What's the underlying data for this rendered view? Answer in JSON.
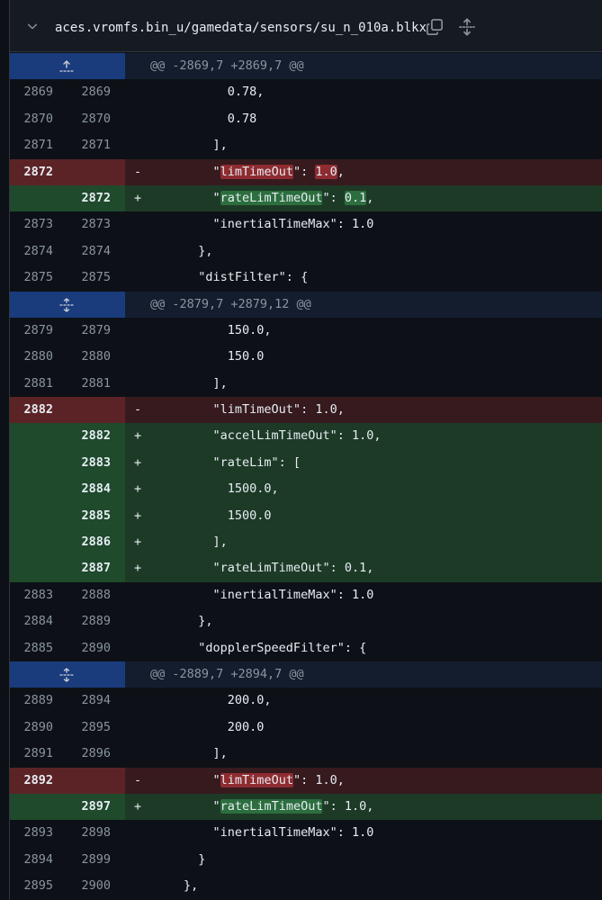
{
  "file": {
    "path": "aces.vromfs.bin_u/gamedata/sensors/su_n_010a.blkx",
    "icons": [
      "chevron-down-icon",
      "copy-icon",
      "expand-all-icon"
    ]
  },
  "colors": {
    "background": "#0d1117",
    "deletion_line": "#361a1e",
    "deletion_gutter": "#5c2326",
    "addition_line": "#1d3a27",
    "addition_gutter": "#1f4a2c",
    "hunk_gutter": "#1a3b7c"
  },
  "rows": [
    {
      "type": "hunk",
      "text": "@@ -2869,7 +2869,7 @@",
      "icon": "expand-up-icon"
    },
    {
      "type": "context",
      "old": "2869",
      "new": "2869",
      "marker": "",
      "segments": [
        {
          "t": "              0.78,"
        }
      ]
    },
    {
      "type": "context",
      "old": "2870",
      "new": "2870",
      "marker": "",
      "segments": [
        {
          "t": "              0.78"
        }
      ]
    },
    {
      "type": "context",
      "old": "2871",
      "new": "2871",
      "marker": "",
      "segments": [
        {
          "t": "            ],"
        }
      ]
    },
    {
      "type": "del",
      "old": "2872",
      "new": "",
      "marker": "-",
      "segments": [
        {
          "t": "            \""
        },
        {
          "t": "limTimeOut",
          "hl": true
        },
        {
          "t": "\": "
        },
        {
          "t": "1.0",
          "hl": true
        },
        {
          "t": ","
        }
      ]
    },
    {
      "type": "add",
      "old": "",
      "new": "2872",
      "marker": "+",
      "segments": [
        {
          "t": "            \""
        },
        {
          "t": "rateLimTimeOut",
          "hl": true
        },
        {
          "t": "\": "
        },
        {
          "t": "0.1",
          "hl": true
        },
        {
          "t": ","
        }
      ]
    },
    {
      "type": "context",
      "old": "2873",
      "new": "2873",
      "marker": "",
      "segments": [
        {
          "t": "            \"inertialTimeMax\": 1.0"
        }
      ]
    },
    {
      "type": "context",
      "old": "2874",
      "new": "2874",
      "marker": "",
      "segments": [
        {
          "t": "          },"
        }
      ]
    },
    {
      "type": "context",
      "old": "2875",
      "new": "2875",
      "marker": "",
      "segments": [
        {
          "t": "          \"distFilter\": {"
        }
      ]
    },
    {
      "type": "hunk",
      "text": "@@ -2879,7 +2879,12 @@",
      "icon": "expand-both-icon"
    },
    {
      "type": "context",
      "old": "2879",
      "new": "2879",
      "marker": "",
      "segments": [
        {
          "t": "              150.0,"
        }
      ]
    },
    {
      "type": "context",
      "old": "2880",
      "new": "2880",
      "marker": "",
      "segments": [
        {
          "t": "              150.0"
        }
      ]
    },
    {
      "type": "context",
      "old": "2881",
      "new": "2881",
      "marker": "",
      "segments": [
        {
          "t": "            ],"
        }
      ]
    },
    {
      "type": "del",
      "old": "2882",
      "new": "",
      "marker": "-",
      "segments": [
        {
          "t": "            \"limTimeOut\": 1.0,"
        }
      ]
    },
    {
      "type": "add",
      "old": "",
      "new": "2882",
      "marker": "+",
      "segments": [
        {
          "t": "            \"accelLimTimeOut\": 1.0,"
        }
      ]
    },
    {
      "type": "add",
      "old": "",
      "new": "2883",
      "marker": "+",
      "segments": [
        {
          "t": "            \"rateLim\": ["
        }
      ]
    },
    {
      "type": "add",
      "old": "",
      "new": "2884",
      "marker": "+",
      "segments": [
        {
          "t": "              1500.0,"
        }
      ]
    },
    {
      "type": "add",
      "old": "",
      "new": "2885",
      "marker": "+",
      "segments": [
        {
          "t": "              1500.0"
        }
      ]
    },
    {
      "type": "add",
      "old": "",
      "new": "2886",
      "marker": "+",
      "segments": [
        {
          "t": "            ],"
        }
      ]
    },
    {
      "type": "add",
      "old": "",
      "new": "2887",
      "marker": "+",
      "segments": [
        {
          "t": "            \"rateLimTimeOut\": 0.1,"
        }
      ]
    },
    {
      "type": "context",
      "old": "2883",
      "new": "2888",
      "marker": "",
      "segments": [
        {
          "t": "            \"inertialTimeMax\": 1.0"
        }
      ]
    },
    {
      "type": "context",
      "old": "2884",
      "new": "2889",
      "marker": "",
      "segments": [
        {
          "t": "          },"
        }
      ]
    },
    {
      "type": "context",
      "old": "2885",
      "new": "2890",
      "marker": "",
      "segments": [
        {
          "t": "          \"dopplerSpeedFilter\": {"
        }
      ]
    },
    {
      "type": "hunk",
      "text": "@@ -2889,7 +2894,7 @@",
      "icon": "expand-both-icon"
    },
    {
      "type": "context",
      "old": "2889",
      "new": "2894",
      "marker": "",
      "segments": [
        {
          "t": "              200.0,"
        }
      ]
    },
    {
      "type": "context",
      "old": "2890",
      "new": "2895",
      "marker": "",
      "segments": [
        {
          "t": "              200.0"
        }
      ]
    },
    {
      "type": "context",
      "old": "2891",
      "new": "2896",
      "marker": "",
      "segments": [
        {
          "t": "            ],"
        }
      ]
    },
    {
      "type": "del",
      "old": "2892",
      "new": "",
      "marker": "-",
      "segments": [
        {
          "t": "            \""
        },
        {
          "t": "limTimeOut",
          "hl": true
        },
        {
          "t": "\": 1.0,"
        }
      ]
    },
    {
      "type": "add",
      "old": "",
      "new": "2897",
      "marker": "+",
      "segments": [
        {
          "t": "            \""
        },
        {
          "t": "rateLimTimeOut",
          "hl": true
        },
        {
          "t": "\": 1.0,"
        }
      ]
    },
    {
      "type": "context",
      "old": "2893",
      "new": "2898",
      "marker": "",
      "segments": [
        {
          "t": "            \"inertialTimeMax\": 1.0"
        }
      ]
    },
    {
      "type": "context",
      "old": "2894",
      "new": "2899",
      "marker": "",
      "segments": [
        {
          "t": "          }"
        }
      ]
    },
    {
      "type": "context",
      "old": "2895",
      "new": "2900",
      "marker": "",
      "segments": [
        {
          "t": "        },"
        }
      ]
    }
  ]
}
